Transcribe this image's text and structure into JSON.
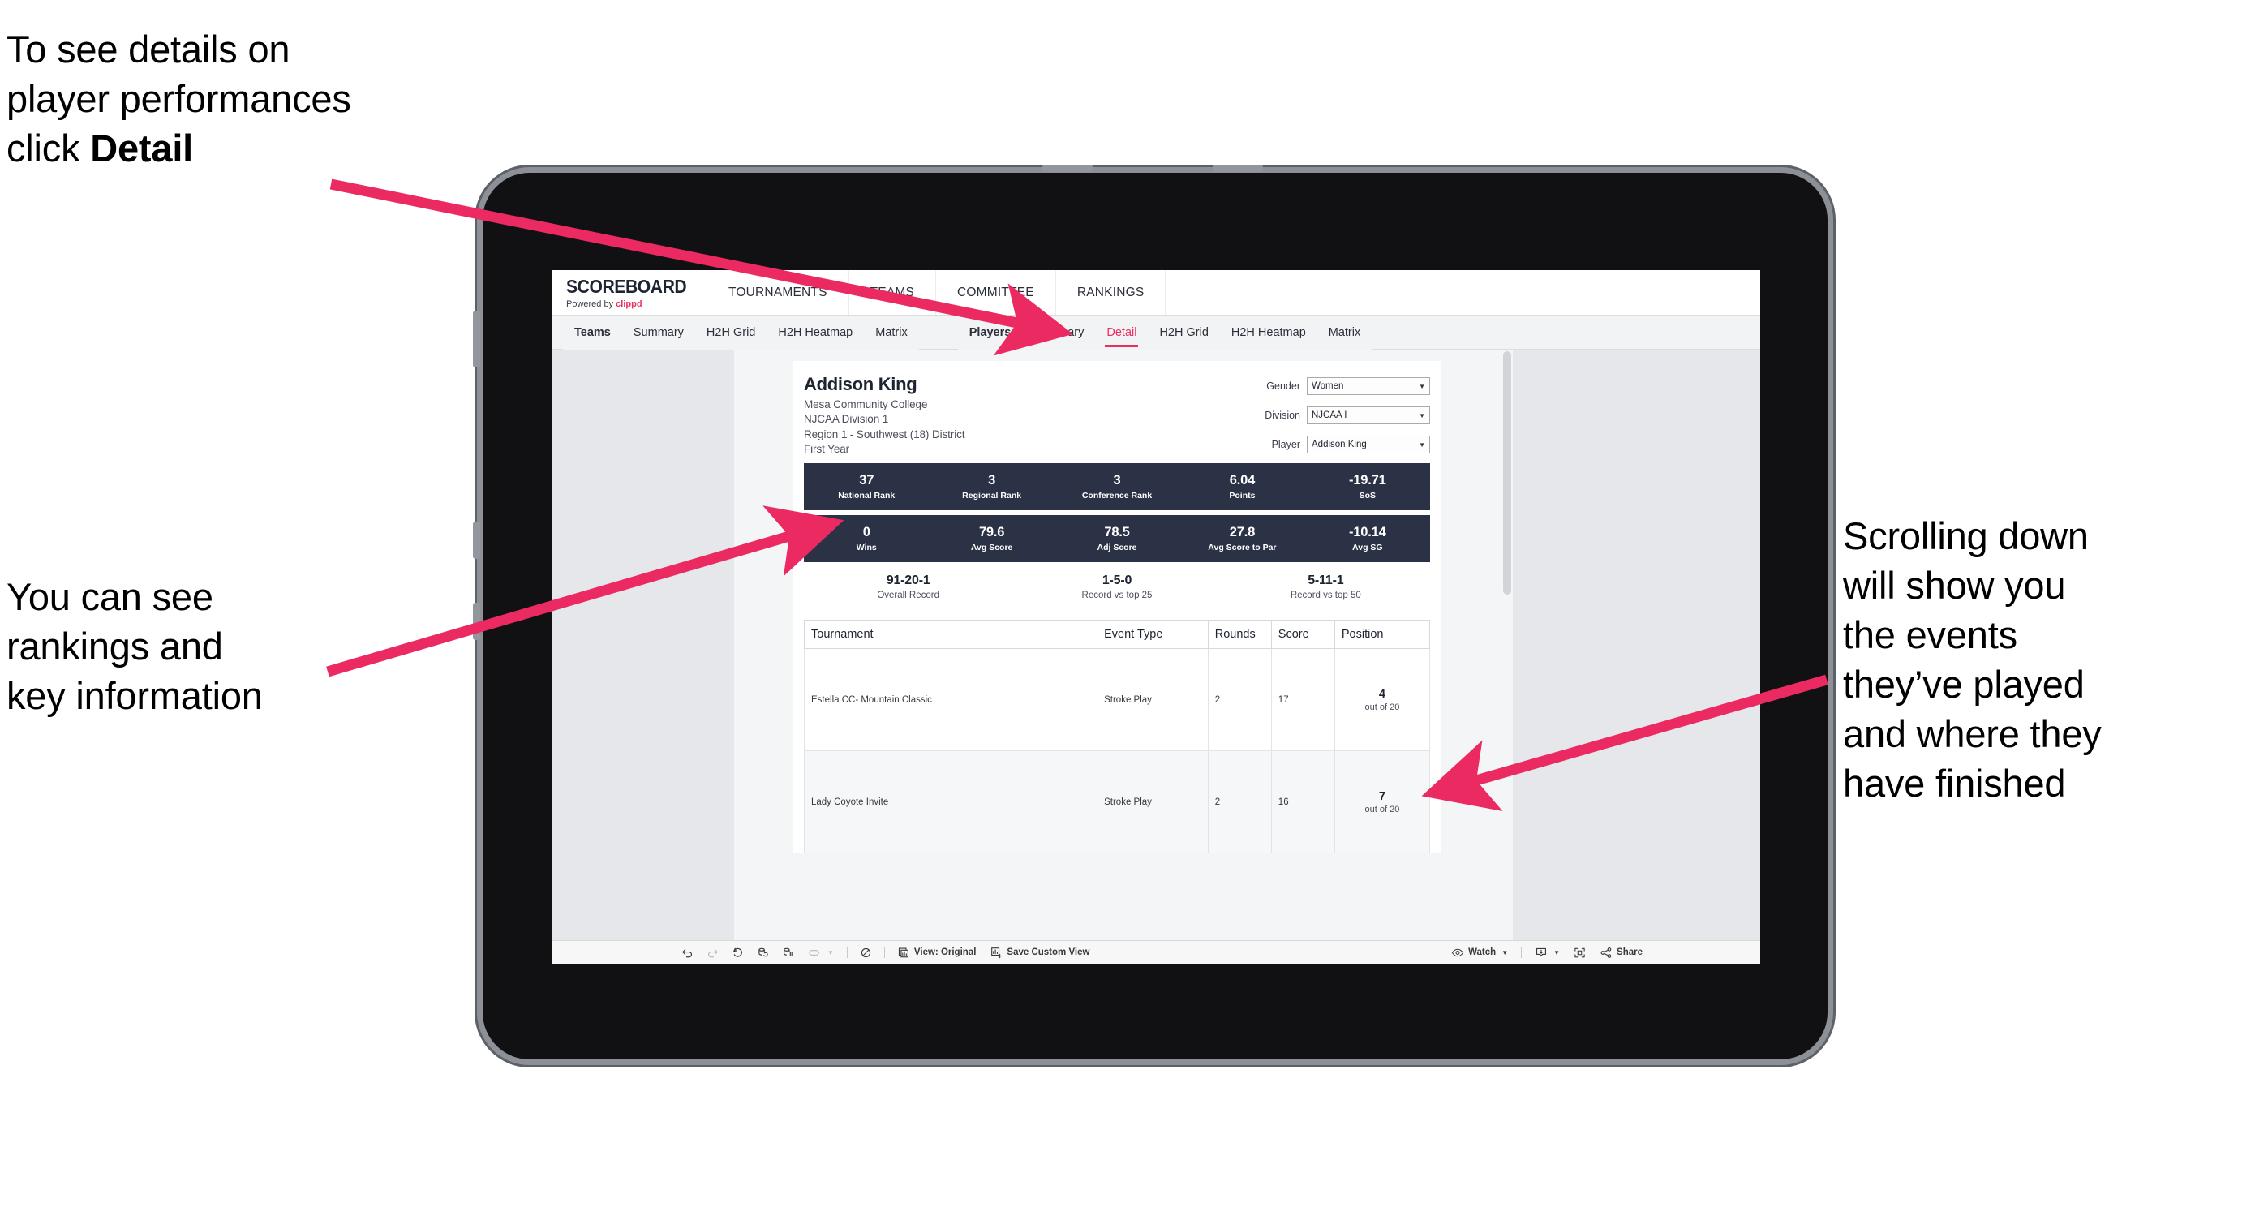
{
  "annotations": {
    "detail_hint": "To see details on\nplayer performances\nclick ",
    "detail_hint_bold": "Detail",
    "rankings_hint": "You can see\nrankings and\nkey information",
    "scroll_hint": "Scrolling down\nwill show you\nthe events\nthey’ve played\nand where they\nhave finished",
    "arrow_color": "#ec2a62"
  },
  "app": {
    "brand": {
      "title": "SCOREBOARD",
      "powered_prefix": "Powered by ",
      "powered_name": "clippd"
    },
    "top_nav": [
      {
        "label": "TOURNAMENTS"
      },
      {
        "label": "TEAMS"
      },
      {
        "label": "COMMITTEE"
      },
      {
        "label": "RANKINGS"
      }
    ],
    "sub_tabs_teams": [
      {
        "label": "Teams",
        "head": true,
        "active": false
      },
      {
        "label": "Summary",
        "head": false,
        "active": false
      },
      {
        "label": "H2H Grid",
        "head": false,
        "active": false
      },
      {
        "label": "H2H Heatmap",
        "head": false,
        "active": false
      },
      {
        "label": "Matrix",
        "head": false,
        "active": false
      }
    ],
    "sub_tabs_players": [
      {
        "label": "Players",
        "head": true,
        "active": false
      },
      {
        "label": "Summary",
        "head": false,
        "active": false
      },
      {
        "label": "Detail",
        "head": false,
        "active": true
      },
      {
        "label": "H2H Grid",
        "head": false,
        "active": false
      },
      {
        "label": "H2H Heatmap",
        "head": false,
        "active": false
      },
      {
        "label": "Matrix",
        "head": false,
        "active": false
      }
    ],
    "accent_color": "#e8315f",
    "band_color": "#2c3246"
  },
  "player": {
    "name": "Addison King",
    "meta": [
      "Mesa Community College",
      "NJCAA Division 1",
      "Region 1 - Southwest (18) District",
      "First Year"
    ]
  },
  "filters": [
    {
      "label": "Gender",
      "value": "Women"
    },
    {
      "label": "Division",
      "value": "NJCAA I"
    },
    {
      "label": "Player",
      "value": "Addison King"
    }
  ],
  "stats_band_1": [
    {
      "value": "37",
      "label": "National Rank"
    },
    {
      "value": "3",
      "label": "Regional Rank"
    },
    {
      "value": "3",
      "label": "Conference Rank"
    },
    {
      "value": "6.04",
      "label": "Points"
    },
    {
      "value": "-19.71",
      "label": "SoS"
    }
  ],
  "stats_band_2": [
    {
      "value": "0",
      "label": "Wins"
    },
    {
      "value": "79.6",
      "label": "Avg Score"
    },
    {
      "value": "78.5",
      "label": "Adj Score"
    },
    {
      "value": "27.8",
      "label": "Avg Score to Par"
    },
    {
      "value": "-10.14",
      "label": "Avg SG"
    }
  ],
  "records": [
    {
      "value": "91-20-1",
      "label": "Overall Record"
    },
    {
      "value": "1-5-0",
      "label": "Record vs top 25"
    },
    {
      "value": "5-11-1",
      "label": "Record vs top 50"
    }
  ],
  "tournament_table": {
    "columns": [
      "Tournament",
      "Event Type",
      "Rounds",
      "Score",
      "Position"
    ],
    "rows": [
      {
        "tournament": "Estella CC- Mountain Classic",
        "event_type": "Stroke Play",
        "rounds": "2",
        "score": "17",
        "position_num": "4",
        "position_of": "out of 20"
      },
      {
        "tournament": "Lady Coyote Invite",
        "event_type": "Stroke Play",
        "rounds": "2",
        "score": "16",
        "position_num": "7",
        "position_of": "out of 20"
      }
    ]
  },
  "toolbar": {
    "view_label": "View: Original",
    "save_label": "Save Custom View",
    "watch_label": "Watch",
    "share_label": "Share"
  }
}
